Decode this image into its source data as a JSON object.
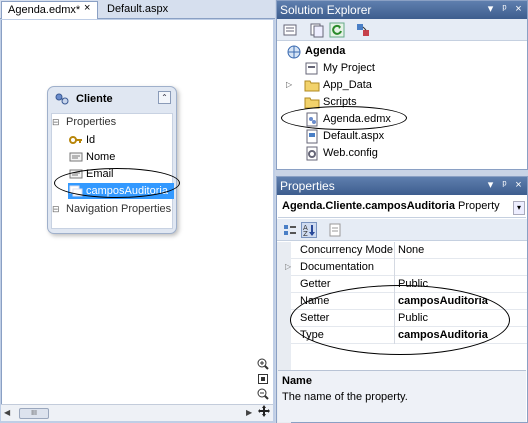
{
  "editor": {
    "tabs": [
      {
        "label": "Agenda.edmx*",
        "active": true
      },
      {
        "label": "Default.aspx",
        "active": false
      }
    ],
    "close_glyph": "×",
    "entity": {
      "name": "Cliente",
      "collapse_glyph": "⌃",
      "sections": {
        "properties": "Properties",
        "navigation": "Navigation Properties"
      },
      "properties": [
        {
          "name": "Id",
          "icon": "key-icon"
        },
        {
          "name": "Nome",
          "icon": "property-icon"
        },
        {
          "name": "Email",
          "icon": "property-icon"
        },
        {
          "name": "camposAuditoria",
          "icon": "complex-property-icon",
          "selected": true
        }
      ]
    },
    "scroll_thumb": "III"
  },
  "solution_explorer": {
    "title": "Solution Explorer",
    "buttons": [
      "▾",
      "ᵖ",
      "×"
    ],
    "tree": [
      {
        "label": "Agenda",
        "icon": "project-icon",
        "level": 0,
        "bold": true
      },
      {
        "label": "My Project",
        "icon": "my-project-icon",
        "level": 1
      },
      {
        "label": "App_Data",
        "icon": "folder-icon",
        "level": 1
      },
      {
        "label": "Scripts",
        "icon": "folder-icon",
        "level": 1,
        "expandable": true
      },
      {
        "label": "Agenda.edmx",
        "icon": "edmx-icon",
        "level": 1
      },
      {
        "label": "Default.aspx",
        "icon": "aspx-icon",
        "level": 1
      },
      {
        "label": "Web.config",
        "icon": "config-icon",
        "level": 1
      }
    ]
  },
  "properties_panel": {
    "title": "Properties",
    "object_name": "Agenda.Cliente.camposAuditoria",
    "object_type": "Property",
    "rows": [
      {
        "name": "Concurrency Mode",
        "value": "None",
        "bold": false
      },
      {
        "name": "Documentation",
        "value": "",
        "bold": false,
        "expandable": true
      },
      {
        "name": "Getter",
        "value": "Public",
        "bold": false
      },
      {
        "name": "Name",
        "value": "camposAuditoria",
        "bold": true
      },
      {
        "name": "Setter",
        "value": "Public",
        "bold": false
      },
      {
        "name": "Type",
        "value": "camposAuditoria",
        "bold": true
      }
    ],
    "description": {
      "title": "Name",
      "text": "The name of the property."
    }
  },
  "colors": {
    "panel_header": "#4a6b9d",
    "selection": "#3399ff",
    "designer_background": "#ffffff"
  }
}
